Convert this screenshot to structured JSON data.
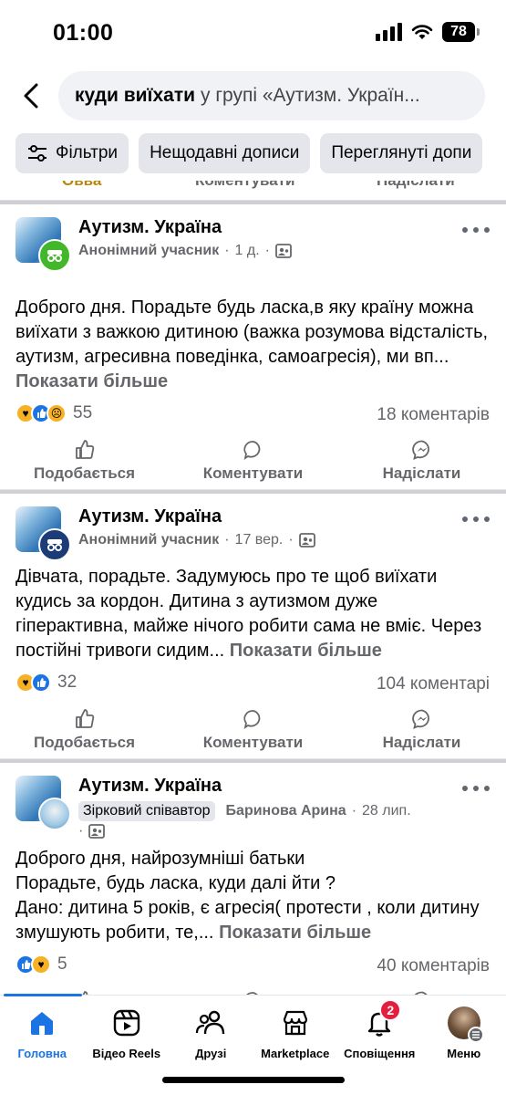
{
  "status": {
    "time": "01:00",
    "battery": "78"
  },
  "search": {
    "query": "куди виїхати",
    "scope": "у групі «Аутизм. Україн..."
  },
  "chips": [
    "Фільтри",
    "Нещодавні дописи",
    "Переглянуті допи"
  ],
  "partial_actions": [
    "Овва",
    "Коментувати",
    "Надіслати"
  ],
  "posts": [
    {
      "group": "Аутизм. Україна",
      "author": "Анонімний учасник",
      "time": "1 д.",
      "text": "Доброго дня. Порадьте будь ласка,в яку країну можна виїхати з важкою дитиною (важка розумова відсталість, аутизм, агресивна поведінка, самоагресія), ми вп...",
      "more": "Показати більше",
      "reactions_count": "55",
      "comments": "18 коментарів"
    },
    {
      "group": "Аутизм. Україна",
      "author": "Анонімний учасник",
      "time": "17 вер.",
      "text": "Дівчата, порадьте. Задумуюсь про те щоб виїхати кудись за кордон. Дитина з аутизмом дуже гіперактивна, майже нічого робити сама не вміє. Через постійні тривоги сидим...",
      "more": "Показати більше",
      "reactions_count": "32",
      "comments": "104 коментарі"
    },
    {
      "group": "Аутизм. Україна",
      "badge": "Зірковий співавтор",
      "author": "Баринова Арина",
      "time": "28 лип.",
      "text_lines": [
        "Доброго дня, найрозумніші батьки",
        "Порадьте, будь ласка, куди далі йти ?",
        "Дано: дитина 5 років, є агресія( протести , коли дитину змушують робити, те,..."
      ],
      "more": "Показати більше",
      "reactions_count": "5",
      "comments": "40 коментарів"
    }
  ],
  "actions": {
    "like": "Подобається",
    "comment": "Коментувати",
    "send": "Надіслати"
  },
  "tabs": {
    "home": "Головна",
    "reels": "Відео Reels",
    "friends": "Друзі",
    "marketplace": "Marketplace",
    "notifications": "Сповіщення",
    "notifications_badge": "2",
    "menu": "Меню"
  },
  "colors": {
    "accent": "#1b74e4",
    "badge": "#e41e3f"
  }
}
